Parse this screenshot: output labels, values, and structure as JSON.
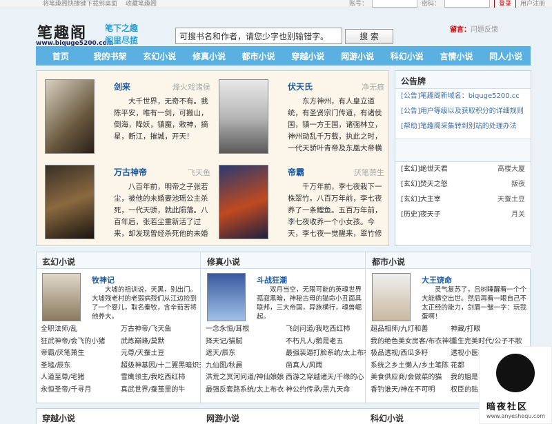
{
  "topbar": {
    "left1": "将笔趣阁快捷键下载到桌面",
    "left2": "收藏笔趣阁",
    "account_label": "账号：",
    "password_label": "密码：",
    "login_btn": "登录",
    "register": "用户注册"
  },
  "logo": {
    "name": "笔趣阁",
    "url": "www.biquge5200.com",
    "slogan1": "笔下之趣",
    "slogan2": "阁里尽揽"
  },
  "search": {
    "placeholder": "可搜书名和作者，请您少字也别输错字。",
    "button": "搜 索"
  },
  "message": {
    "label": "留言：",
    "text": "问题反馈"
  },
  "nav": [
    "首页",
    "我的书架",
    "玄幻小说",
    "修真小说",
    "都市小说",
    "穿越小说",
    "网游小说",
    "科幻小说",
    "言情小说",
    "同人小说"
  ],
  "featured": [
    {
      "title": "剑来",
      "author": "烽火戏诸侯",
      "desc": "大千世界，无奇不有。我陈平安，唯有一剑，可搬山，倒海，降妖，镇魔，敕神，摘星，断江，摧城，开天！"
    },
    {
      "title": "伏天氏",
      "author": "净无痕",
      "desc": "东方神州，有人皇立道统，有圣贤宗门传道，有诸侯国，镇一方王国，诸强林立，神州动乱千万载，执此之时，一代天骄叶青帝及东凰大帝横空出世，新人皇，叙圣贤，诸侯臣服，东方神州一统！"
    },
    {
      "title": "万古神帝",
      "author": "飞天鱼",
      "desc": "八百年前，明帝之子张若尘，被他的未婚妻池瑶公主杀死，一代天骄，就此陨落。八百年后，张若尘重新活了过来，却发现曾经杀死他的未婚妻，已经统一昆仑界，开辟出第一中央帝国，号称“池瑶女"
    },
    {
      "title": "帝霸",
      "author": "厌笔萧生",
      "desc": "千万年前，李七夜栽下一株翠竹。八百万年前，李七夜养了一条鲤鱼。五百万年前，李七夜收养一个小女孩。今天，李七夜一觉醒来，翠竹修练成神灵，鲤鱼化作金龙，小女孩成"
    }
  ],
  "notice_board": {
    "title": "公告牌",
    "notices": [
      {
        "tag": "[公告]",
        "text": "笔趣阁新域名：biquge5200.cc"
      },
      {
        "tag": "[公告]",
        "text": "用户等级以及获取积分的详细规则"
      },
      {
        "tag": "[帮助]",
        "text": "笔趣阁采集转到别站的处理办法"
      }
    ],
    "books": [
      {
        "tag": "[玄幻]",
        "title": "绝世天君",
        "author": "高楼大厦"
      },
      {
        "tag": "[玄幻]",
        "title": "焚天之怒",
        "author": "叛夜"
      },
      {
        "tag": "[玄幻]",
        "title": "大主宰",
        "author": "天蚕土豆"
      },
      {
        "tag": "[历史]",
        "title": "夜天子",
        "author": "月关"
      }
    ]
  },
  "categories": [
    {
      "name": "玄幻小说",
      "feature": {
        "title": "牧神记",
        "desc": "大墟的祖训说，天黑，别出门。大墟残老村的老弱病残们从江边捡到了一个婴儿，取名秦牧，含辛茹苦将他养大。"
      },
      "list": [
        [
          "全职法师/乱",
          "万古神帝/飞天鱼"
        ],
        [
          "狂武神帝/会飞的小猪",
          "武炼巅峰/莫默"
        ],
        [
          "帝霸/厌笔萧生",
          "元尊/天蚕土豆"
        ],
        [
          "圣墟/辰东",
          "超级神基因/十二翼黑暗炽天使"
        ],
        [
          "人道至尊/宅猪",
          "雪鹰领主/我吃西红柿"
        ],
        [
          "永恒圣帝/千寻月",
          "真武世界/蚕茧里的牛"
        ]
      ]
    },
    {
      "name": "修真小说",
      "feature": {
        "title": "斗战狂潮",
        "desc": "双月当空，无限可能的英魂世界孤寂黑暗，神秘古母的猫命小丑面具联邦，三大帝国，异族横行，魂兽崛起。"
      },
      "list": [
        [
          "一念永恒/耳根",
          "飞剑问道/我吃西红柿"
        ],
        [
          "择天记/猫腻",
          "不朽凡人/鹅是老五"
        ],
        [
          "遮天/辰东",
          "最强装逼打脸系统/太上布衣"
        ],
        [
          "九仙图/秋晨",
          "凿真人/风雨"
        ],
        [
          "洪荒之冥河问道/神仙娘娘",
          "西游之穿越诸天/千缘的心"
        ],
        [
          "最强反套路系统/太上布衣",
          "神公约传承/黑九天命"
        ]
      ]
    },
    {
      "name": "都市小说",
      "feature": {
        "title": "大王饶命",
        "desc": "灵气复苏了，吕树睡醒看一个个大能横空出世。然后再看一眼自己不太正经的能力，剑眉一皱一字：玩我蛋啊！"
      },
      "list": [
        [
          "超品相师/九灯和善",
          "神藏/打眼"
        ],
        [
          "我的绝色美女房客/布衣神相",
          "重生完美时代/公子不歌"
        ],
        [
          "极品透视/西瓜多籽",
          "透视小医神/"
        ],
        [
          "系统之乡土懒人/乡土笔陈",
          "花都"
        ],
        [
          "美食供应商/会做菜的猫",
          "我的姐是"
        ],
        [
          "香钓谁天/神在不可明",
          "权臣的贴身"
        ]
      ]
    }
  ],
  "bottom": [
    "穿越小说",
    "网游小说",
    "科幻小说"
  ],
  "watermark": {
    "title": "暗夜社区",
    "url": "www.anyeshequ.com"
  }
}
